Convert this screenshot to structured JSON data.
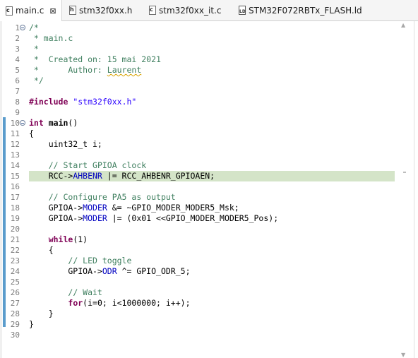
{
  "tabs": [
    {
      "label": "main.c",
      "icon": "c-source-file-icon",
      "glyph": "c",
      "active": true,
      "close": "⊠"
    },
    {
      "label": "stm32f0xx.h",
      "icon": "h-header-file-icon",
      "glyph": "h",
      "active": false
    },
    {
      "label": "stm32f0xx_it.c",
      "icon": "c-source-file-icon",
      "glyph": "c",
      "active": false
    },
    {
      "label": "STM32F072RBTx_FLASH.ld",
      "icon": "ld-linker-file-icon",
      "glyph": "LD",
      "active": false
    }
  ],
  "editor": {
    "current_line": 15,
    "line_numbers": [
      "1",
      "2",
      "3",
      "4",
      "5",
      "6",
      "7",
      "8",
      "9",
      "10",
      "11",
      "12",
      "13",
      "14",
      "15",
      "16",
      "17",
      "18",
      "19",
      "20",
      "21",
      "22",
      "23",
      "24",
      "25",
      "26",
      "27",
      "28",
      "29",
      "30"
    ],
    "fold_lines": [
      1,
      10
    ],
    "lines": [
      [
        {
          "t": "/*",
          "c": "c"
        }
      ],
      [
        {
          "t": " * main.c",
          "c": "c"
        }
      ],
      [
        {
          "t": " *",
          "c": "c"
        }
      ],
      [
        {
          "t": " *  Created on: 15 mai 2021",
          "c": "c"
        }
      ],
      [
        {
          "t": " *      Author: ",
          "c": "c"
        },
        {
          "t": "Laurent",
          "c": "c sq"
        }
      ],
      [
        {
          "t": " */",
          "c": "c"
        }
      ],
      [
        {
          "t": "",
          "c": ""
        }
      ],
      [
        {
          "t": "#include",
          "c": "k"
        },
        {
          "t": " ",
          "c": ""
        },
        {
          "t": "\"stm32f0xx.h\"",
          "c": "s"
        }
      ],
      [
        {
          "t": "",
          "c": ""
        }
      ],
      [
        {
          "t": "int",
          "c": "k"
        },
        {
          "t": " ",
          "c": ""
        },
        {
          "t": "main",
          "c": "b"
        },
        {
          "t": "()",
          "c": ""
        }
      ],
      [
        {
          "t": "{",
          "c": ""
        }
      ],
      [
        {
          "t": "    uint32_t i;",
          "c": ""
        }
      ],
      [
        {
          "t": "",
          "c": ""
        }
      ],
      [
        {
          "t": "    ",
          "c": ""
        },
        {
          "t": "// Start GPIOA clock",
          "c": "c"
        }
      ],
      [
        {
          "t": "    RCC->",
          "c": ""
        },
        {
          "t": "AHBENR",
          "c": "f"
        },
        {
          "t": " |= RCC_AHBENR_GPIOAEN;",
          "c": ""
        }
      ],
      [
        {
          "t": "",
          "c": ""
        }
      ],
      [
        {
          "t": "    ",
          "c": ""
        },
        {
          "t": "// Configure PA5 as output",
          "c": "c"
        }
      ],
      [
        {
          "t": "    GPIOA->",
          "c": ""
        },
        {
          "t": "MODER",
          "c": "f"
        },
        {
          "t": " &= ~GPIO_MODER_MODER5_Msk;",
          "c": ""
        }
      ],
      [
        {
          "t": "    GPIOA->",
          "c": ""
        },
        {
          "t": "MODER",
          "c": "f"
        },
        {
          "t": " |= (0x01 <<GPIO_MODER_MODER5_Pos);",
          "c": ""
        }
      ],
      [
        {
          "t": "",
          "c": ""
        }
      ],
      [
        {
          "t": "    ",
          "c": ""
        },
        {
          "t": "while",
          "c": "k"
        },
        {
          "t": "(1)",
          "c": ""
        }
      ],
      [
        {
          "t": "    {",
          "c": ""
        }
      ],
      [
        {
          "t": "        ",
          "c": ""
        },
        {
          "t": "// LED toggle",
          "c": "c"
        }
      ],
      [
        {
          "t": "        GPIOA->",
          "c": ""
        },
        {
          "t": "ODR",
          "c": "f"
        },
        {
          "t": " ^= GPIO_ODR_5;",
          "c": ""
        }
      ],
      [
        {
          "t": "",
          "c": ""
        }
      ],
      [
        {
          "t": "        ",
          "c": ""
        },
        {
          "t": "// Wait",
          "c": "c"
        }
      ],
      [
        {
          "t": "        ",
          "c": ""
        },
        {
          "t": "for",
          "c": "k"
        },
        {
          "t": "(i=0; i<1000000; i++);",
          "c": ""
        }
      ],
      [
        {
          "t": "    }",
          "c": ""
        }
      ],
      [
        {
          "t": "}",
          "c": ""
        }
      ],
      [
        {
          "t": "",
          "c": ""
        }
      ]
    ]
  },
  "colors": {
    "comment": "#3f7f5f",
    "keyword": "#7f0055",
    "string": "#2a00ff",
    "field": "#0000c0",
    "current_line_bg": "#d4e4c8",
    "change_bar": "#5b9ccc"
  }
}
